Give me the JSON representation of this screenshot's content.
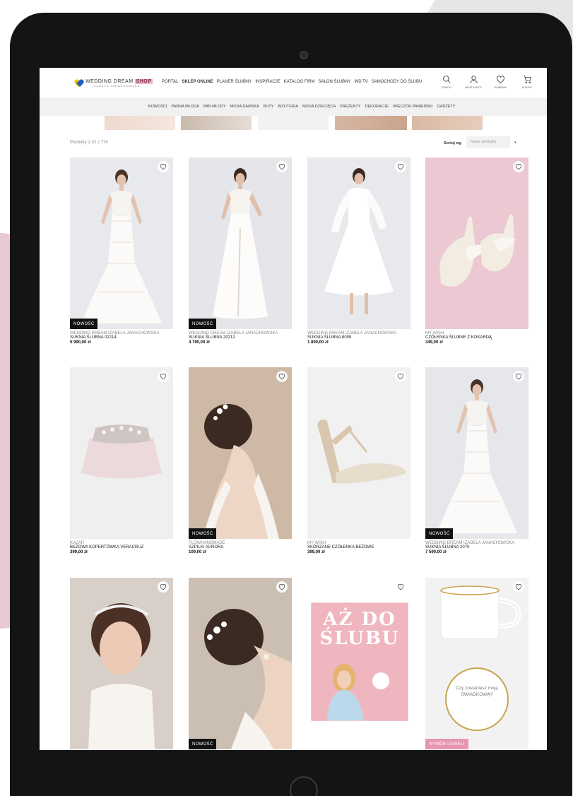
{
  "logo": {
    "main": "WEDDING DREAM",
    "shop": "SHOP",
    "sub": "IZABELA JANACHOWSKA"
  },
  "main_nav": [
    "PORTAL",
    "SKLEP ONLINE",
    "PLANER ŚLUBNY",
    "INSPIRACJE",
    "KATALOG FIRM",
    "SALON ŚLUBNY",
    "WD TV",
    "SAMOCHODY DO ŚLUBU"
  ],
  "main_nav_active": "SKLEP ONLINE",
  "header_icons": [
    {
      "name": "search-icon",
      "label": "SZUKAJ"
    },
    {
      "name": "user-icon",
      "label": "MOJE KONTO"
    },
    {
      "name": "heart-icon",
      "label": "ULUBIONE"
    },
    {
      "name": "cart-icon",
      "label": "KOSZYK"
    }
  ],
  "sub_nav": [
    "NOWOŚCI",
    "PANNA MŁODA",
    "PAN MŁODY",
    "MODA DAMSKA",
    "BUTY",
    "BIŻUTERIA",
    "MODA DZIECIĘCA",
    "PREZENTY",
    "DEKORACJE",
    "WIECZÓR PANIEŃSKI",
    "GADŻETY"
  ],
  "listing": {
    "count": "Produkty 1-32 z 776",
    "sort_label": "Sortuj wg",
    "sort_value": "Nowe produkty",
    "sort_arrow": "▾"
  },
  "products": [
    {
      "brand": "WEDDING DREAM IZABELA JANACHOWSKA",
      "name": "SUKNIA ŚLUBNA 02214",
      "price": "5 990,00 zł",
      "badge": "NOWOŚĆ",
      "badge_style": "dark",
      "image": "dress-lace",
      "bg": "#e7e9ec"
    },
    {
      "brand": "WEDDING DREAM IZABELA JANACHOWSKA",
      "name": "SUKNIA ŚLUBNA 20212",
      "price": "4 790,00 zł",
      "badge": "NOWOŚĆ",
      "badge_style": "dark",
      "image": "dress-tulle",
      "bg": "#e4e6ea"
    },
    {
      "brand": "WEDDING DREAM IZABELA JANACHOWSKA",
      "name": "SUKNIA ŚLUBNA 8009",
      "price": "1 890,00 zł",
      "badge": "",
      "badge_style": "",
      "image": "dress-sleeves",
      "bg": "#e8e9ec"
    },
    {
      "brand": "MY WISH",
      "name": "CZÓŁENKA ŚLUBNE Z KOKARDĄ",
      "price": "349,00 zł",
      "badge": "",
      "badge_style": "",
      "image": "shoes-bow",
      "bg": "#ecc8d2"
    },
    {
      "brand": "KAZAR",
      "name": "BEŻOWA KOPERTÓWKA VERACRUZ",
      "price": "399,00 zł",
      "badge": "",
      "badge_style": "",
      "image": "clutch",
      "bg": "#efefef"
    },
    {
      "brand": "FLOWHANDMADE",
      "name": "SZPILKI AURORA",
      "price": "109,00 zł",
      "badge": "NOWOŚĆ",
      "badge_style": "dark",
      "image": "hairpins",
      "bg": "#c7b3a0"
    },
    {
      "brand": "MY WISH",
      "name": "SKÓRZANE CZÓŁENKA BEŻOWE",
      "price": "399,00 zł",
      "badge": "",
      "badge_style": "",
      "image": "heels-beige",
      "bg": "#f1f1f1"
    },
    {
      "brand": "WEDDING DREAM IZABELA JANACHOWSKA",
      "name": "SUKNIA ŚLUBNA 2070",
      "price": "7 590,00 zł",
      "badge": "NOWOŚĆ",
      "badge_style": "dark",
      "image": "dress-offshoulder",
      "bg": "#e6e7ea"
    },
    {
      "brand": "",
      "name": "",
      "price": "",
      "badge": "",
      "badge_style": "",
      "image": "headband",
      "bg": "#d9d2cb"
    },
    {
      "brand": "",
      "name": "",
      "price": "",
      "badge": "NOWOŚĆ",
      "badge_style": "dark",
      "image": "hair-flowers",
      "bg": "#cfc4b8"
    },
    {
      "brand": "",
      "name": "",
      "price": "",
      "badge": "",
      "badge_style": "",
      "image": "book",
      "bg": "#ffffff",
      "book_title": "AŻ DO ŚLUBU"
    },
    {
      "brand": "",
      "name": "",
      "price": "",
      "badge": "WYBÓR IZABELI",
      "badge_style": "pink",
      "image": "mug",
      "bg": "#f2f2f2",
      "mug_text": "Czy zostaniesz moją ŚWIADKOWĄ?"
    }
  ],
  "colors": {
    "accent_pink": "#e895b0",
    "shop_badge": "#e7b6c4",
    "new_badge": "#111111",
    "subnav_bg": "#f1f1f1"
  }
}
